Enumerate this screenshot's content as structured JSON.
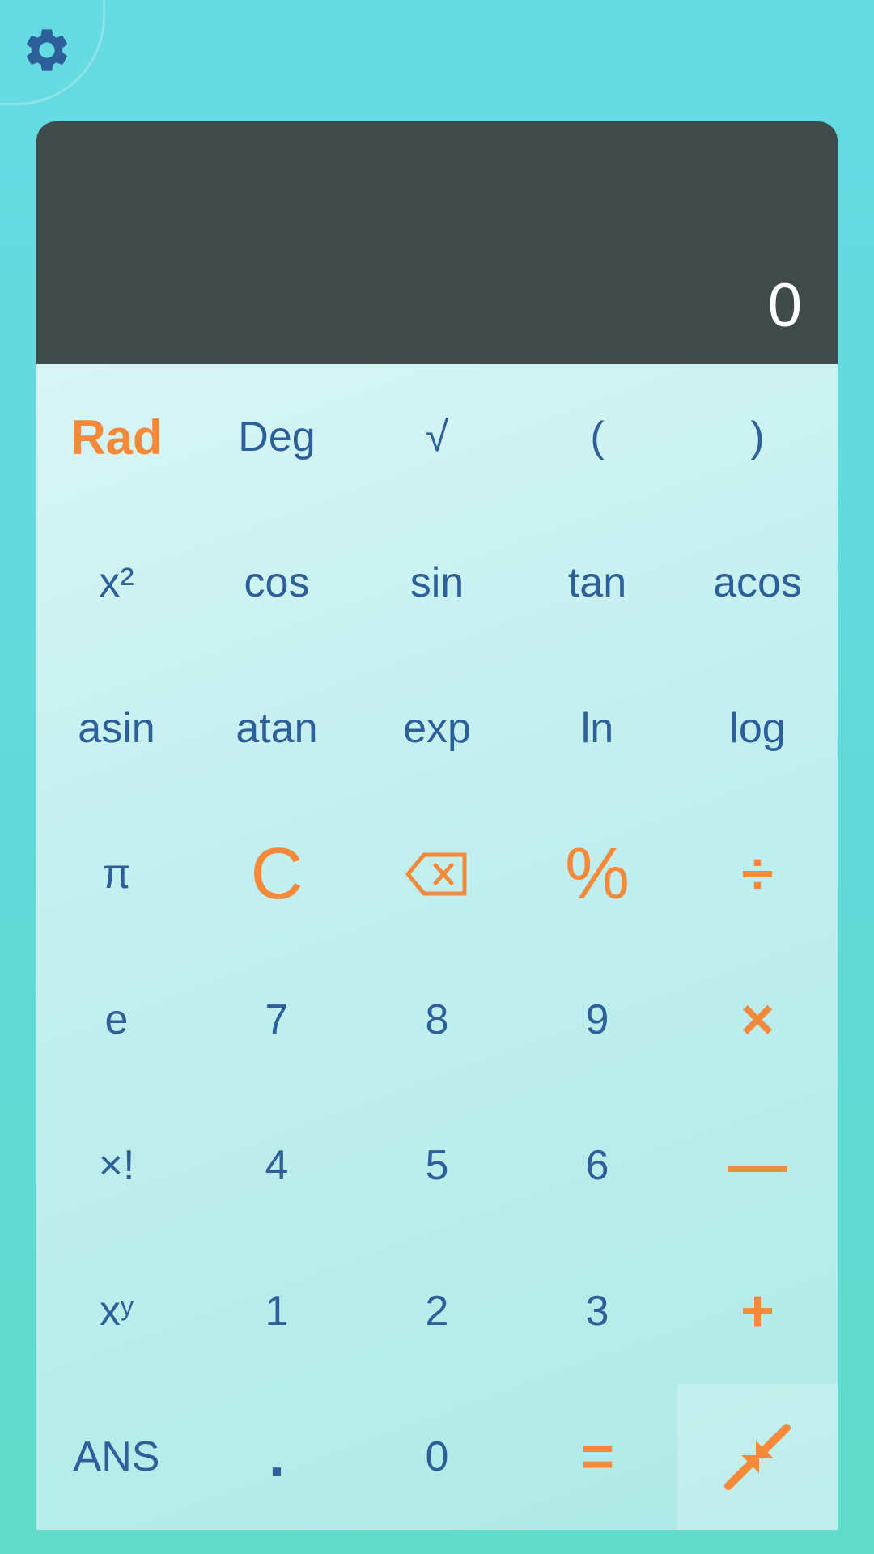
{
  "display": {
    "value": "0"
  },
  "icons": {
    "settings": "gear-icon",
    "backspace": "backspace-icon",
    "minimize": "minimize-arrows-icon"
  },
  "colors": {
    "accent": "#f5893a",
    "text": "#2d5f9a",
    "display_bg": "#3f4a4b",
    "display_text": "#ffffff"
  },
  "keys": {
    "rad": "Rad",
    "deg": "Deg",
    "sqrt": "√",
    "lparen": "(",
    "rparen": ")",
    "square": "x²",
    "cos": "cos",
    "sin": "sin",
    "tan": "tan",
    "acos": "acos",
    "asin": "asin",
    "atan": "atan",
    "exp": "exp",
    "ln": "ln",
    "log": "log",
    "pi": "π",
    "clear": "C",
    "percent": "%",
    "divide": "÷",
    "e": "e",
    "seven": "7",
    "eight": "8",
    "nine": "9",
    "multiply": "×",
    "factorial": "×!",
    "four": "4",
    "five": "5",
    "six": "6",
    "minus": "—",
    "power_base": "x",
    "power_exp": "y",
    "one": "1",
    "two": "2",
    "three": "3",
    "plus": "+",
    "ans": "ANS",
    "dot": ".",
    "zero": "0",
    "equals": "="
  }
}
